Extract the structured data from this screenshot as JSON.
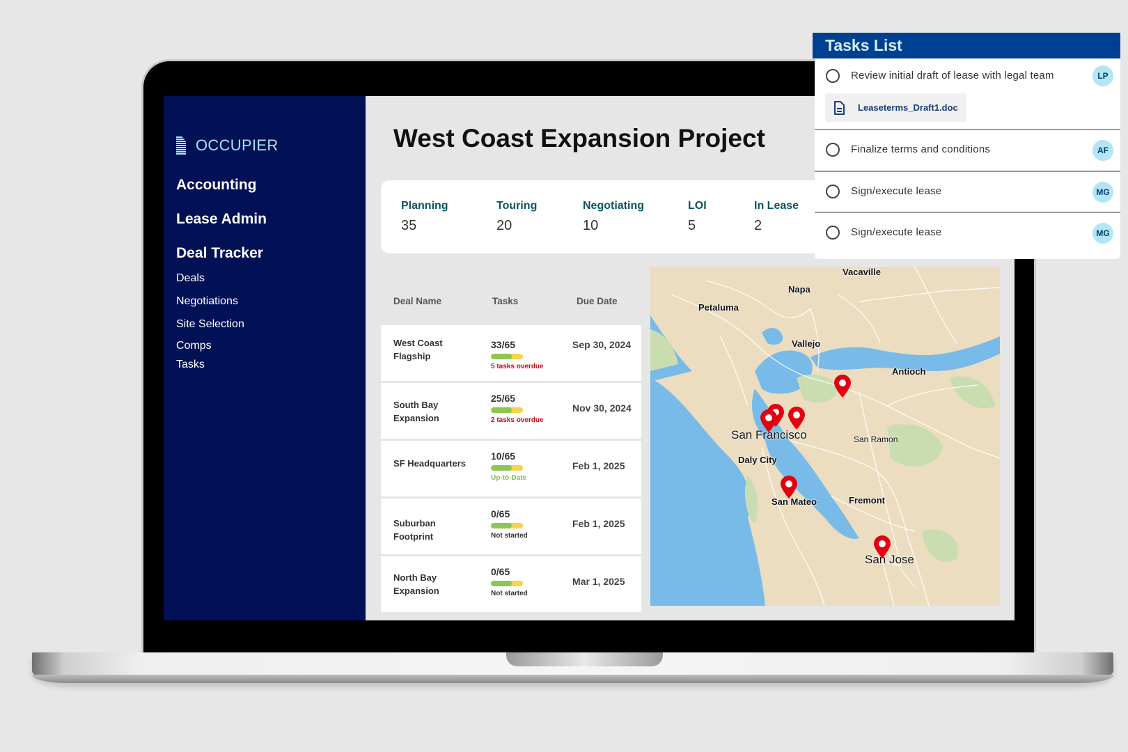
{
  "app": {
    "brand": "OCCUPIER",
    "page_title": "West Coast Expansion Project"
  },
  "sidebar": {
    "main_items": [
      "Accounting",
      "Lease Admin",
      "Deal Tracker"
    ],
    "sub_items": [
      "Deals",
      "Negotiations",
      "Site Selection",
      "Comps",
      "Tasks"
    ]
  },
  "stats": [
    {
      "label": "Planning",
      "value": "35"
    },
    {
      "label": "Touring",
      "value": "20"
    },
    {
      "label": "Negotiating",
      "value": "10"
    },
    {
      "label": "LOI",
      "value": "5"
    },
    {
      "label": "In Lease",
      "value": "2"
    }
  ],
  "deals_table": {
    "columns": [
      "Deal Name",
      "Tasks",
      "Due Date"
    ],
    "rows": [
      {
        "name": "West Coast Flagship",
        "tasks": "33/65",
        "progress": 0.66,
        "status": "5 tasks overdue",
        "status_type": "overdue",
        "due": "Sep 30, 2024"
      },
      {
        "name": "South Bay Expansion",
        "tasks": "25/65",
        "progress": 0.66,
        "status": "2 tasks overdue",
        "status_type": "overdue",
        "due": "Nov 30, 2024"
      },
      {
        "name": "SF Headquarters",
        "tasks": "10/65",
        "progress": 0.66,
        "status": "Up-to-Date",
        "status_type": "ok",
        "due": "Feb 1, 2025"
      },
      {
        "name": "Suburban Footprint",
        "tasks": "0/65",
        "progress": 0.66,
        "status": "Not started",
        "status_type": "neutral",
        "due": "Feb 1, 2025"
      },
      {
        "name": "North Bay Expansion",
        "tasks": "0/65",
        "progress": 0.66,
        "status": "Not started",
        "status_type": "neutral",
        "due": "Mar 1, 2025"
      }
    ]
  },
  "map": {
    "cities": [
      "Vacaville",
      "Napa",
      "Petaluma",
      "Vallejo",
      "Antioch",
      "San Francisco",
      "San Ramon",
      "Daly City",
      "San Mateo",
      "Fremont",
      "San Jose"
    ],
    "pin_count": 6
  },
  "tasks_panel": {
    "title": "Tasks List",
    "items": [
      {
        "text": "Review initial draft of lease with legal team",
        "assignee": "LP",
        "attachment": "Leaseterms_Draft1.doc"
      },
      {
        "text": "Finalize terms and conditions",
        "assignee": "AF"
      },
      {
        "text": "Sign/execute lease",
        "assignee": "MG"
      },
      {
        "text": "Sign/execute lease",
        "assignee": "MG"
      }
    ]
  },
  "colors": {
    "sidebar_bg": "#021155",
    "tasks_header_bg": "#004093",
    "stat_label": "#0b5560",
    "overdue": "#c0121c",
    "uptodate": "#7fbf4d",
    "pin": "#e3000f"
  }
}
